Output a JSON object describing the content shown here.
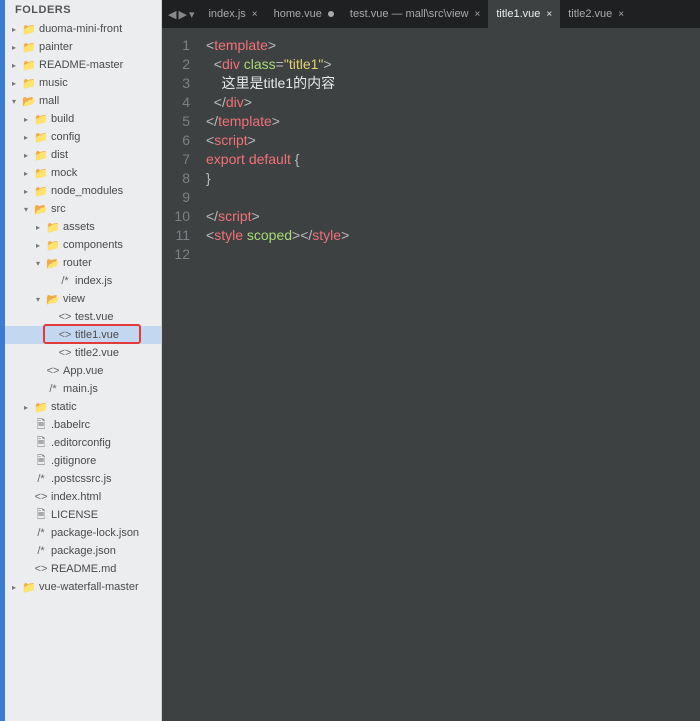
{
  "sidebar": {
    "header": "FOLDERS",
    "items": [
      {
        "depth": 0,
        "arrow": "▸",
        "icon": "folder",
        "label": "duoma-mini-front"
      },
      {
        "depth": 0,
        "arrow": "▸",
        "icon": "folder",
        "label": "painter"
      },
      {
        "depth": 0,
        "arrow": "▸",
        "icon": "folder",
        "label": "README-master"
      },
      {
        "depth": 0,
        "arrow": "▸",
        "icon": "folder",
        "label": "music"
      },
      {
        "depth": 0,
        "arrow": "▾",
        "icon": "folder-open",
        "label": "mall"
      },
      {
        "depth": 1,
        "arrow": "▸",
        "icon": "folder",
        "label": "build"
      },
      {
        "depth": 1,
        "arrow": "▸",
        "icon": "folder",
        "label": "config"
      },
      {
        "depth": 1,
        "arrow": "▸",
        "icon": "folder",
        "label": "dist"
      },
      {
        "depth": 1,
        "arrow": "▸",
        "icon": "folder",
        "label": "mock"
      },
      {
        "depth": 1,
        "arrow": "▸",
        "icon": "folder",
        "label": "node_modules"
      },
      {
        "depth": 1,
        "arrow": "▾",
        "icon": "folder-open",
        "label": "src"
      },
      {
        "depth": 2,
        "arrow": "▸",
        "icon": "folder",
        "label": "assets"
      },
      {
        "depth": 2,
        "arrow": "▸",
        "icon": "folder",
        "label": "components"
      },
      {
        "depth": 2,
        "arrow": "▾",
        "icon": "folder-open",
        "label": "router"
      },
      {
        "depth": 3,
        "arrow": "",
        "icon": "js",
        "label": "index.js"
      },
      {
        "depth": 2,
        "arrow": "▾",
        "icon": "folder-open",
        "label": "view"
      },
      {
        "depth": 3,
        "arrow": "",
        "icon": "vue",
        "label": "test.vue"
      },
      {
        "depth": 3,
        "arrow": "",
        "icon": "vue",
        "label": "title1.vue",
        "selected": true,
        "boxed": true
      },
      {
        "depth": 3,
        "arrow": "",
        "icon": "vue",
        "label": "title2.vue"
      },
      {
        "depth": 2,
        "arrow": "",
        "icon": "vue",
        "label": "App.vue"
      },
      {
        "depth": 2,
        "arrow": "",
        "icon": "js",
        "label": "main.js"
      },
      {
        "depth": 1,
        "arrow": "▸",
        "icon": "folder",
        "label": "static"
      },
      {
        "depth": 1,
        "arrow": "",
        "icon": "file",
        "label": ".babelrc"
      },
      {
        "depth": 1,
        "arrow": "",
        "icon": "file",
        "label": ".editorconfig"
      },
      {
        "depth": 1,
        "arrow": "",
        "icon": "file",
        "label": ".gitignore"
      },
      {
        "depth": 1,
        "arrow": "",
        "icon": "js",
        "label": ".postcssrc.js"
      },
      {
        "depth": 1,
        "arrow": "",
        "icon": "vue",
        "label": "index.html"
      },
      {
        "depth": 1,
        "arrow": "",
        "icon": "file",
        "label": "LICENSE"
      },
      {
        "depth": 1,
        "arrow": "",
        "icon": "js",
        "label": "package-lock.json"
      },
      {
        "depth": 1,
        "arrow": "",
        "icon": "js",
        "label": "package.json"
      },
      {
        "depth": 1,
        "arrow": "",
        "icon": "vue",
        "label": "README.md"
      },
      {
        "depth": 0,
        "arrow": "▸",
        "icon": "folder",
        "label": "vue-waterfall-master"
      }
    ]
  },
  "tabs": [
    {
      "label": "index.js",
      "close": "×"
    },
    {
      "label": "home.vue",
      "dirty": true
    },
    {
      "label": "test.vue — mall\\src\\view",
      "close": "×"
    },
    {
      "label": "title1.vue",
      "close": "×",
      "active": true
    },
    {
      "label": "title2.vue",
      "close": "×"
    }
  ],
  "code": {
    "lines": [
      [
        {
          "t": "<",
          "c": "p"
        },
        {
          "t": "template",
          "c": "tag"
        },
        {
          "t": ">",
          "c": "p"
        }
      ],
      [
        {
          "t": "  <",
          "c": "p"
        },
        {
          "t": "div",
          "c": "tag"
        },
        {
          "t": " ",
          "c": "p"
        },
        {
          "t": "class",
          "c": "attr"
        },
        {
          "t": "=",
          "c": "p"
        },
        {
          "t": "\"title1\"",
          "c": "str"
        },
        {
          "t": ">",
          "c": "p"
        }
      ],
      [
        {
          "t": "    这里是title1的内容",
          "c": "text"
        }
      ],
      [
        {
          "t": "  </",
          "c": "p"
        },
        {
          "t": "div",
          "c": "tag"
        },
        {
          "t": ">",
          "c": "p"
        }
      ],
      [
        {
          "t": "</",
          "c": "p"
        },
        {
          "t": "template",
          "c": "tag"
        },
        {
          "t": ">",
          "c": "p"
        }
      ],
      [
        {
          "t": "<",
          "c": "p"
        },
        {
          "t": "script",
          "c": "tag"
        },
        {
          "t": ">",
          "c": "p"
        }
      ],
      [
        {
          "t": "export",
          "c": "kw"
        },
        {
          "t": " ",
          "c": "p"
        },
        {
          "t": "default",
          "c": "kw"
        },
        {
          "t": " {",
          "c": "p"
        }
      ],
      [
        {
          "t": "}",
          "c": "p"
        }
      ],
      [],
      [
        {
          "t": "</",
          "c": "p"
        },
        {
          "t": "script",
          "c": "tag"
        },
        {
          "t": ">",
          "c": "p"
        }
      ],
      [
        {
          "t": "<",
          "c": "p"
        },
        {
          "t": "style",
          "c": "tag"
        },
        {
          "t": " ",
          "c": "p"
        },
        {
          "t": "scoped",
          "c": "attr"
        },
        {
          "t": "></",
          "c": "p"
        },
        {
          "t": "style",
          "c": "tag"
        },
        {
          "t": ">",
          "c": "p"
        }
      ],
      []
    ]
  },
  "iconmap": {
    "folder": "📁",
    "folder-open": "📂",
    "file": "🗎",
    "js": "/*",
    "vue": "<>"
  }
}
